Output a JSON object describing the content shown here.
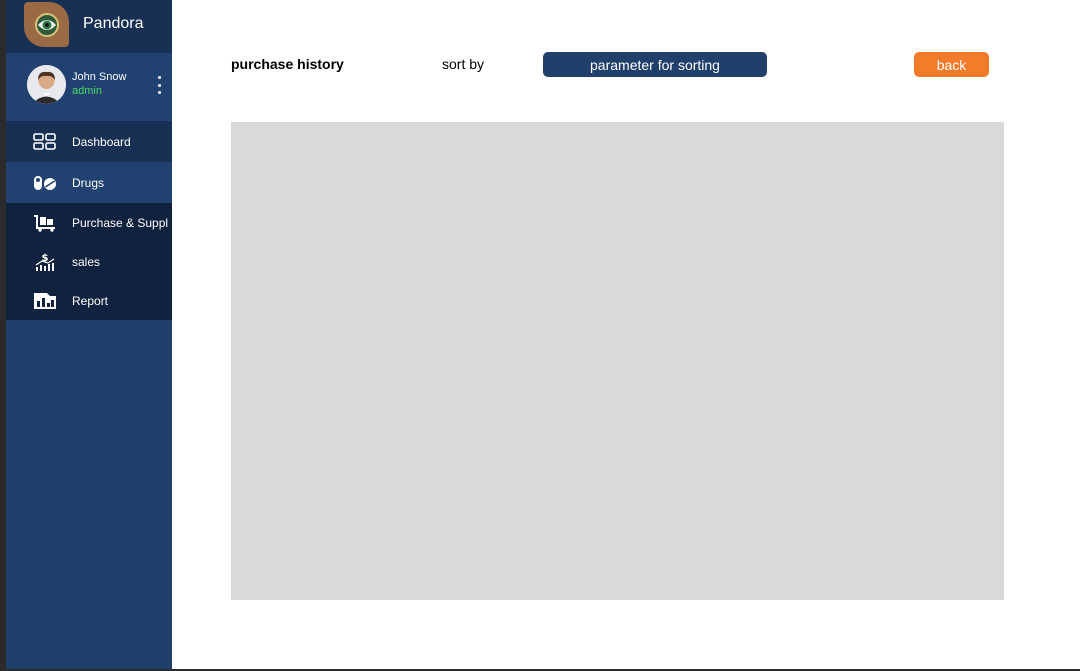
{
  "app": {
    "brand_name": "Pandora"
  },
  "user": {
    "name": "John Snow",
    "role": "admin"
  },
  "sidebar": {
    "items": [
      {
        "label": "Dashboard",
        "icon": "dashboard-grid-icon"
      },
      {
        "label": "Drugs",
        "icon": "pills-icon"
      },
      {
        "label": "Purchase & Suppl",
        "icon": "cart-icon"
      },
      {
        "label": "sales",
        "icon": "money-chart-icon"
      },
      {
        "label": "Report",
        "icon": "report-chart-icon"
      }
    ]
  },
  "header": {
    "title": "purchase history",
    "sort_label": "sort by",
    "sort_value": "parameter for sorting",
    "back_label": "back"
  },
  "colors": {
    "sidebar": "#203f6b",
    "sidebar_dark": "#10223d",
    "accent": "#f27b2a",
    "role": "#4cd964",
    "panel": "#d9d9d9"
  }
}
